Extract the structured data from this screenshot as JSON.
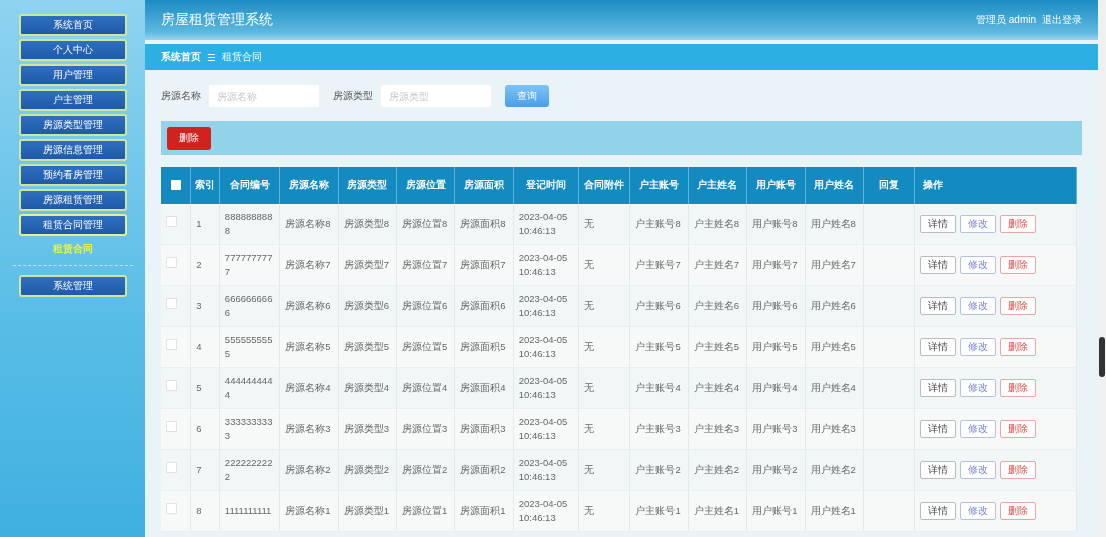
{
  "sidebar": {
    "items": [
      {
        "label": "系统首页",
        "expanded": false
      },
      {
        "label": "个人中心",
        "expanded": false
      },
      {
        "label": "用户管理",
        "expanded": false
      },
      {
        "label": "户主管理",
        "expanded": false
      },
      {
        "label": "房源类型管理",
        "expanded": false
      },
      {
        "label": "房源信息管理",
        "expanded": false
      },
      {
        "label": "预约看房管理",
        "expanded": false
      },
      {
        "label": "房源租赁管理",
        "expanded": false
      },
      {
        "label": "租赁合同管理",
        "expanded": true,
        "children": [
          {
            "label": "租赁合同"
          }
        ]
      },
      {
        "label": "系统管理",
        "expanded": false
      }
    ]
  },
  "header": {
    "title": "房屋租赁管理系统",
    "user": "管理员 admin",
    "logout": "退出登录"
  },
  "breadcrumb": [
    "系统首页",
    "租赁合同"
  ],
  "breadcrumb_separator": "☰",
  "search": {
    "fields": [
      {
        "label": "房源名称",
        "placeholder": "房源名称"
      },
      {
        "label": "房源类型",
        "placeholder": "房源类型"
      }
    ],
    "button": "查询"
  },
  "toolbar": {
    "delete_button": "删除"
  },
  "table": {
    "header_checkbox": {
      "checked": false
    },
    "columns": [
      "索引",
      "合同编号",
      "房源名称",
      "房源类型",
      "房源位置",
      "房源面积",
      "登记时间",
      "合同附件",
      "户主账号",
      "户主姓名",
      "用户账号",
      "用户姓名",
      "回复",
      "操作"
    ],
    "rows": [
      {
        "checked": false,
        "cells": [
          "1",
          "8888888888",
          "房源名称8",
          "房源类型8",
          "房源位置8",
          "房源面积8",
          "2023-04-05 10:46:13",
          "无",
          "户主账号8",
          "户主姓名8",
          "用户账号8",
          "用户姓名8"
        ],
        "actions": [
          {
            "label": "详情",
            "kind": "detail"
          },
          {
            "label": "修改",
            "kind": "edit"
          },
          {
            "label": "删除",
            "kind": "delete"
          }
        ]
      },
      {
        "checked": false,
        "cells": [
          "2",
          "7777777777",
          "房源名称7",
          "房源类型7",
          "房源位置7",
          "房源面积7",
          "2023-04-05 10:46:13",
          "无",
          "户主账号7",
          "户主姓名7",
          "用户账号7",
          "用户姓名7"
        ],
        "actions": [
          {
            "label": "详情",
            "kind": "detail"
          },
          {
            "label": "修改",
            "kind": "edit"
          },
          {
            "label": "删除",
            "kind": "delete"
          }
        ]
      },
      {
        "checked": false,
        "cells": [
          "3",
          "6666666666",
          "房源名称6",
          "房源类型6",
          "房源位置6",
          "房源面积6",
          "2023-04-05 10:46:13",
          "无",
          "户主账号6",
          "户主姓名6",
          "用户账号6",
          "用户姓名6"
        ],
        "actions": [
          {
            "label": "详情",
            "kind": "detail"
          },
          {
            "label": "修改",
            "kind": "edit"
          },
          {
            "label": "删除",
            "kind": "delete"
          }
        ]
      },
      {
        "checked": false,
        "cells": [
          "4",
          "5555555555",
          "房源名称5",
          "房源类型5",
          "房源位置5",
          "房源面积5",
          "2023-04-05 10:46:13",
          "无",
          "户主账号5",
          "户主姓名5",
          "用户账号5",
          "用户姓名5"
        ],
        "actions": [
          {
            "label": "详情",
            "kind": "detail"
          },
          {
            "label": "修改",
            "kind": "edit"
          },
          {
            "label": "删除",
            "kind": "delete"
          }
        ]
      },
      {
        "checked": false,
        "cells": [
          "5",
          "4444444444",
          "房源名称4",
          "房源类型4",
          "房源位置4",
          "房源面积4",
          "2023-04-05 10:46:13",
          "无",
          "户主账号4",
          "户主姓名4",
          "用户账号4",
          "用户姓名4"
        ],
        "actions": [
          {
            "label": "详情",
            "kind": "detail"
          },
          {
            "label": "修改",
            "kind": "edit"
          },
          {
            "label": "删除",
            "kind": "delete"
          }
        ]
      },
      {
        "checked": false,
        "cells": [
          "6",
          "3333333333",
          "房源名称3",
          "房源类型3",
          "房源位置3",
          "房源面积3",
          "2023-04-05 10:46:13",
          "无",
          "户主账号3",
          "户主姓名3",
          "用户账号3",
          "用户姓名3"
        ],
        "actions": [
          {
            "label": "详情",
            "kind": "detail"
          },
          {
            "label": "修改",
            "kind": "edit"
          },
          {
            "label": "删除",
            "kind": "delete"
          }
        ]
      },
      {
        "checked": false,
        "cells": [
          "7",
          "2222222222",
          "房源名称2",
          "房源类型2",
          "房源位置2",
          "房源面积2",
          "2023-04-05 10:46:13",
          "无",
          "户主账号2",
          "户主姓名2",
          "用户账号2",
          "用户姓名2"
        ],
        "actions": [
          {
            "label": "详情",
            "kind": "detail"
          },
          {
            "label": "修改",
            "kind": "edit"
          },
          {
            "label": "删除",
            "kind": "delete"
          }
        ]
      },
      {
        "checked": false,
        "cells": [
          "8",
          "1111111111",
          "房源名称1",
          "房源类型1",
          "房源位置1",
          "房源面积1",
          "2023-04-05 10:46:13",
          "无",
          "户主账号1",
          "户主姓名1",
          "用户账号1",
          "用户姓名1"
        ],
        "actions": [
          {
            "label": "详情",
            "kind": "detail"
          },
          {
            "label": "修改",
            "kind": "edit"
          },
          {
            "label": "删除",
            "kind": "delete"
          }
        ]
      }
    ]
  }
}
